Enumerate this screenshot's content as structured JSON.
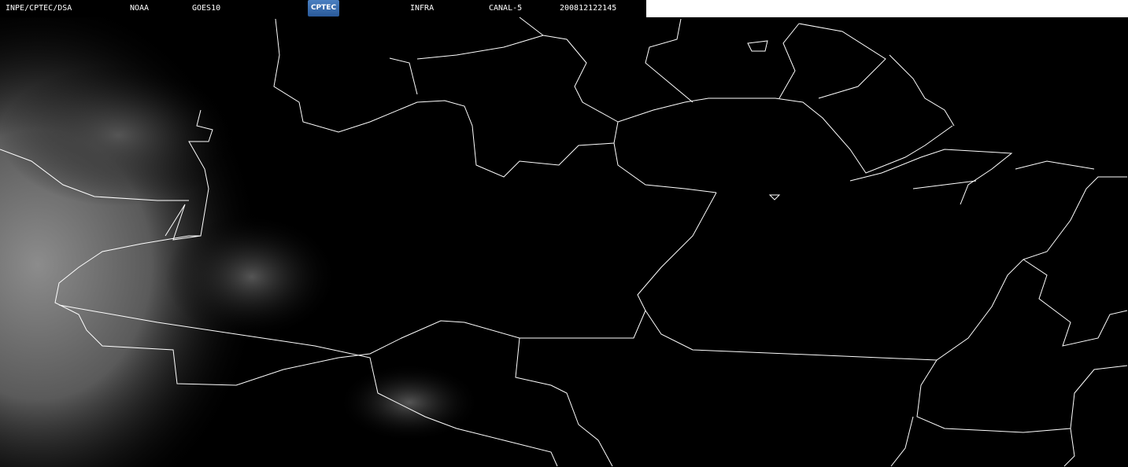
{
  "header": {
    "institution": "INPE/CPTEC/DSA",
    "agency": "NOAA",
    "satellite": "GOES10",
    "logo_text": "CPTEC",
    "band": "INFRA",
    "channel": "CANAL-5",
    "timestamp": "200812122145"
  },
  "colors": {
    "background": "#000000",
    "border_lines": "#ffffff",
    "clouds": "#8a8a8a"
  }
}
